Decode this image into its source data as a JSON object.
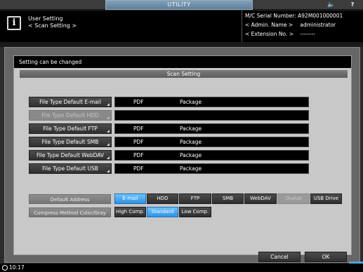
{
  "topbar": {
    "tab_label": "UTILITY",
    "speaker_icon": "speaker-icon",
    "help_label": "?"
  },
  "header": {
    "info_glyph": "i",
    "title_line1": "User Setting",
    "title_line2": "< Scan Setting >",
    "serial_label": "M/C Serial Number:",
    "serial_value": "A92M001000001",
    "admin_label": "< Admin. Name >",
    "admin_value": "administrator",
    "extension_label": "< Extension No. >",
    "extension_value": "--------"
  },
  "panel": {
    "message": "Setting can be changed",
    "section_title": "Scan Setting"
  },
  "rows": [
    {
      "label": "File Type Default E-mail",
      "value1": "PDF",
      "value2": "Package",
      "enabled": true
    },
    {
      "label": "File Type Default HDD",
      "value1": "",
      "value2": "",
      "enabled": false
    },
    {
      "label": "File Type Default FTP",
      "value1": "PDF",
      "value2": "Package",
      "enabled": true
    },
    {
      "label": "File Type Default SMB",
      "value1": "PDF",
      "value2": "Package",
      "enabled": true
    },
    {
      "label": "File Type Default WebDAV",
      "value1": "PDF",
      "value2": "Package",
      "enabled": true
    },
    {
      "label": "File Type Default USB",
      "value1": "PDF",
      "value2": "Package",
      "enabled": true
    }
  ],
  "default_address": {
    "label": "Default Address",
    "options": [
      "E-mail",
      "HDD",
      "FTP",
      "SMB",
      "WebDAV",
      "Queue",
      "USB Drive"
    ],
    "selected": "E-mail",
    "disabled": [
      "Queue"
    ]
  },
  "compress": {
    "label": "Compress Method Color/Gray",
    "options": [
      "High Comp.",
      "Standard",
      "Low Comp."
    ],
    "selected": "Standard"
  },
  "actions": {
    "cancel": "Cancel",
    "ok": "OK"
  },
  "status": {
    "time": "10:17"
  },
  "colors": {
    "selected_blue": "#2e93e6",
    "panel_gray": "#c8c8c8"
  }
}
